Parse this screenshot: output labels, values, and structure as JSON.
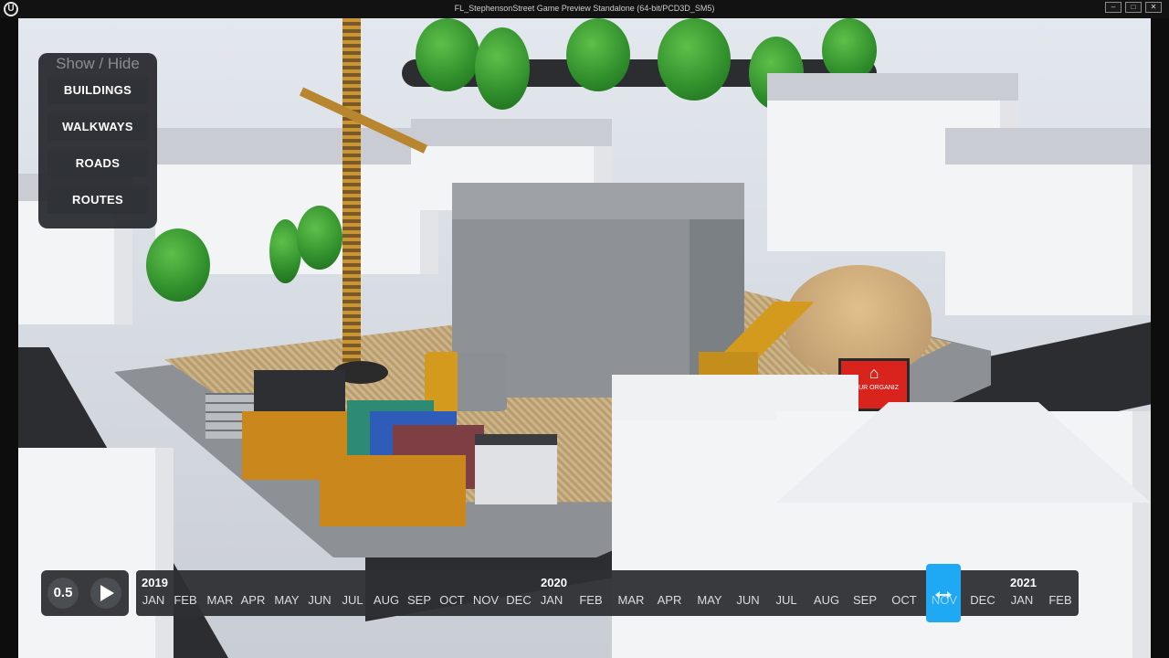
{
  "window": {
    "title": "FL_StephensonStreet Game Preview Standalone (64-bit/PCD3D_SM5)",
    "logo": "U",
    "buttons": [
      "minimize-icon",
      "maximize-icon",
      "close-icon"
    ]
  },
  "panel": {
    "title": "Show / Hide",
    "buttons": [
      "BUILDINGS",
      "WALKWAYS",
      "ROADS",
      "ROUTES"
    ]
  },
  "sign": {
    "text": "YOUR ORGANIZ"
  },
  "timeline": {
    "speed": "0.5",
    "play_icon": "play-icon",
    "years": [
      "2019",
      "2020",
      "2021"
    ],
    "months": [
      "JAN",
      "FEB",
      "MAR",
      "APR",
      "MAY",
      "JUN",
      "JUL",
      "AUG",
      "SEP",
      "OCT",
      "NOV",
      "DEC",
      "JAN",
      "FEB",
      "MAR",
      "APR",
      "MAY",
      "JUN",
      "JUL",
      "AUG",
      "SEP",
      "OCT",
      "NOV",
      "DEC",
      "JAN",
      "FEB"
    ],
    "selected_month": "NOV",
    "selected_index": 22,
    "accent_color": "#1fa9f5"
  }
}
